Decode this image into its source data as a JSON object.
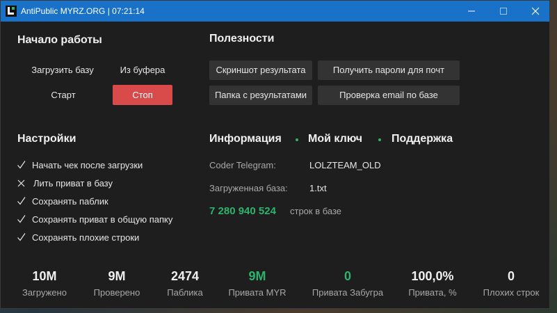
{
  "window": {
    "title": "AntiPublic MYRZ.ORG | 07:21:14",
    "icons": [
      "app-icon",
      "minimize-icon",
      "maximize-icon",
      "close-icon"
    ]
  },
  "start": {
    "title": "Начало работы",
    "load_db": "Загрузить базу",
    "from_clipboard": "Из буфера",
    "start": "Старт",
    "stop": "Стоп"
  },
  "utilities": {
    "title": "Полезности",
    "screenshot": "Скриншот результата",
    "get_passwords": "Получить пароли для почт",
    "results_folder": "Папка с результатами",
    "check_email": "Проверка email по базе"
  },
  "settings": {
    "title": "Настройки",
    "items": [
      {
        "label": "Начать чек после загрузки",
        "checked": true
      },
      {
        "label": "Лить приват в базу",
        "checked": false
      },
      {
        "label": "Сохранять паблик",
        "checked": true
      },
      {
        "label": "Сохранять приват в общую папку",
        "checked": true
      },
      {
        "label": "Сохранять плохие строки",
        "checked": true
      }
    ]
  },
  "info": {
    "tabs": [
      "Информация",
      "Мой ключ",
      "Поддержка"
    ],
    "coder_label": "Coder Telegram:",
    "coder_value": "LOLZTEAM_OLD",
    "base_label": "Загруженная база:",
    "base_value": "1.txt",
    "lines_count": "7 280 940 524",
    "lines_label": "строк в базе"
  },
  "stats": [
    {
      "value": "10M",
      "label": "Загружено",
      "green": false
    },
    {
      "value": "9M",
      "label": "Проверено",
      "green": false
    },
    {
      "value": "2474",
      "label": "Паблика",
      "green": false
    },
    {
      "value": "9M",
      "label": "Привата MYR",
      "green": true
    },
    {
      "value": "0",
      "label": "Привата Забугра",
      "green": true
    },
    {
      "value": "100,0%",
      "label": "Привата, %",
      "green": false
    },
    {
      "value": "0",
      "label": "Плохих строк",
      "green": false
    }
  ],
  "colors": {
    "titlebar": "#1a72c8",
    "background": "#1e1e1e",
    "accent_green": "#2db36b",
    "stop_red": "#d94a4a",
    "button_gray": "#333333"
  }
}
